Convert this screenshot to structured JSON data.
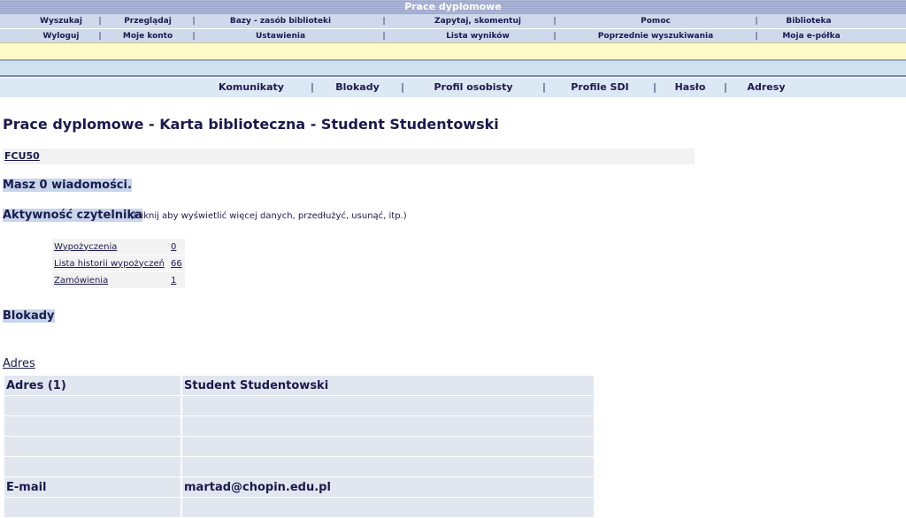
{
  "header": {
    "title": "Prace dyplomowe"
  },
  "menu_row1": [
    "Wyszukaj",
    "Przeglądaj",
    "Bazy - zasób biblioteki",
    "Zapytaj, skomentuj",
    "Pomoc",
    "Biblioteka"
  ],
  "menu_row2": [
    "Wyloguj",
    "Moje konto",
    "Ustawienia",
    "Lista wyników",
    "Poprzednie wyszukiwania",
    "Moja e-półka"
  ],
  "separator": "|",
  "submenu": [
    "Komunikaty",
    "Blokady",
    "Profil osobisty",
    "Profile SDI",
    "Hasło",
    "Adresy"
  ],
  "page_title": "Prace dyplomowe - Karta biblioteczna - Student Studentowski",
  "reader_code": "FCU50",
  "messages": "Masz 0 wiadomości.",
  "activity": {
    "heading": "Aktywność czytelnika",
    "note": "(kliknij aby wyświetlić więcej danych, przedłużyć, usunąć, itp.)",
    "rows": [
      {
        "label": "Wypożyczenia",
        "value": "0"
      },
      {
        "label": "Lista historii wypożyczeń",
        "value": "66"
      },
      {
        "label": "Zamówienia",
        "value": "1"
      }
    ]
  },
  "blocks_heading": "Blokady",
  "address": {
    "link": "Adres",
    "rows": [
      {
        "label": "Adres (1)",
        "value": "Student Studentowski"
      },
      {
        "label": "",
        "value": ""
      },
      {
        "label": "",
        "value": ""
      },
      {
        "label": "",
        "value": ""
      },
      {
        "label": "",
        "value": ""
      },
      {
        "label": "E-mail",
        "value": "martad@chopin.edu.pl"
      },
      {
        "label": "",
        "value": ""
      }
    ]
  }
}
